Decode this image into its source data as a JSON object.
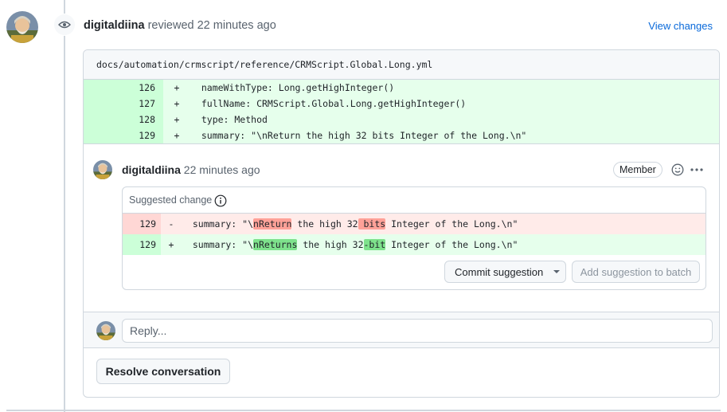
{
  "review": {
    "author": "digitaldiina",
    "action_text": "reviewed 22 minutes ago",
    "view_changes_label": "View changes",
    "icon": "eye-icon"
  },
  "file": {
    "path": "docs/automation/crmscript/reference/CRMScript.Global.Long.yml",
    "lines": [
      {
        "num": "126",
        "sign": "+",
        "code": "  nameWithType: Long.getHighInteger()"
      },
      {
        "num": "127",
        "sign": "+",
        "code": "  fullName: CRMScript.Global.Long.getHighInteger()"
      },
      {
        "num": "128",
        "sign": "+",
        "code": "  type: Method"
      },
      {
        "num": "129",
        "sign": "+",
        "code": "  summary: \"\\nReturn the high 32 bits Integer of the Long.\\n\""
      }
    ]
  },
  "comment": {
    "author": "digitaldiina",
    "time": "22 minutes ago",
    "badge": "Member",
    "suggested_label": "Suggested change",
    "del_line": {
      "num": "129",
      "sign": "-",
      "pre": "  summary: \"\\",
      "hl1": "nReturn",
      "mid": " the high 32",
      "hl2": " bits",
      "post": " Integer of the Long.\\n\""
    },
    "add_line": {
      "num": "129",
      "sign": "+",
      "pre": "  summary: \"\\",
      "hl1": "nReturns",
      "mid": " the high 32",
      "hl2": "-bit",
      "post": " Integer of the Long.\\n\""
    },
    "commit_label": "Commit suggestion",
    "batch_label": "Add suggestion to batch"
  },
  "reply": {
    "placeholder": "Reply..."
  },
  "resolve_label": "Resolve conversation",
  "colors": {
    "link": "#0969da",
    "add_bg": "#e6ffec",
    "del_bg": "#ffebe9"
  }
}
